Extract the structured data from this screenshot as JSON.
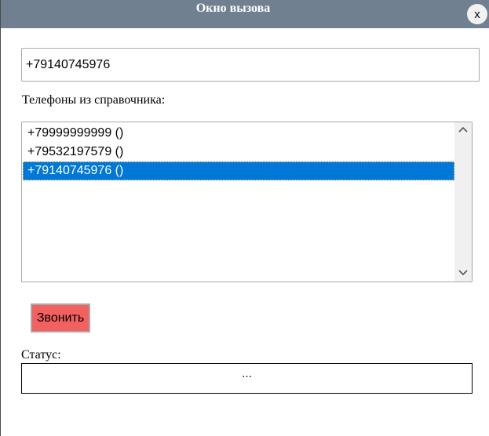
{
  "dialog": {
    "title": "Окно вызова",
    "close_label": "x"
  },
  "phone_input": {
    "value": "+79140745976"
  },
  "phones_label": "Телефоны из справочника:",
  "phone_list": {
    "items": [
      {
        "label": "+79999999999 ()",
        "selected": false
      },
      {
        "label": "+79532197579 ()",
        "selected": false
      },
      {
        "label": "+79140745976 ()",
        "selected": true
      }
    ]
  },
  "call_button": {
    "label": "Звонить"
  },
  "status": {
    "label": "Статус:",
    "value": "..."
  },
  "colors": {
    "titlebar": "#708090",
    "call_button": "#f2615f",
    "selection": "#0078d7"
  },
  "icons": {
    "scroll_up": "chevron-up-icon",
    "scroll_down": "chevron-down-icon"
  }
}
